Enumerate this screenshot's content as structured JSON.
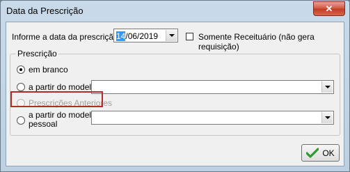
{
  "window": {
    "title": "Data da Prescrição",
    "close_glyph": "✕"
  },
  "date_row": {
    "label": "Informe a data da prescrição",
    "date_selected": "14",
    "date_rest": "/06/2019",
    "checkbox_label": "Somente Receituário (não gera requisição)"
  },
  "prescricao": {
    "title": "Prescrição",
    "options": [
      {
        "label": "em branco",
        "checked": true,
        "enabled": true
      },
      {
        "label": "a partir do modelo",
        "checked": false,
        "enabled": true,
        "combo_value": ""
      },
      {
        "label": "Prescrições Anteriores",
        "checked": false,
        "enabled": false
      },
      {
        "label_line1": "a partir do modelo",
        "label_line2": "pessoal",
        "checked": false,
        "enabled": true,
        "combo_value": ""
      }
    ]
  },
  "ok_button": {
    "label": "OK",
    "icon": "check-icon"
  },
  "colors": {
    "accent_selection": "#3399ff",
    "highlight_border": "#b22a2a",
    "check_green": "#2e9a2e"
  }
}
